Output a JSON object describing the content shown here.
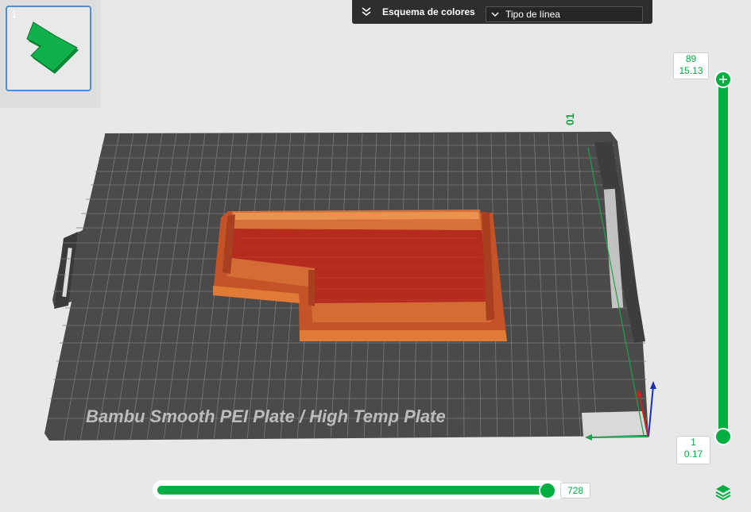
{
  "plate_thumbnail": {
    "number": "1"
  },
  "toolbar": {
    "color_scheme_label": "Esquema de colores",
    "color_scheme_value": "Tipo de línea"
  },
  "plate": {
    "label": "Bambu Smooth PEI Plate / High Temp Plate",
    "marker": "01"
  },
  "layer_slider": {
    "top_layer": "89",
    "top_height": "15.13",
    "bottom_layer": "1",
    "bottom_height": "0.17"
  },
  "move_slider": {
    "value": "728"
  },
  "colors": {
    "accent": "#00ae42",
    "bed": "#4a4a4a",
    "model_wall": "#c8602a",
    "model_infill": "#b52b1e"
  },
  "icons": {
    "collapse": "chevrons-down-icon",
    "dropdown": "chevron-down-icon",
    "layers": "layers-icon"
  }
}
